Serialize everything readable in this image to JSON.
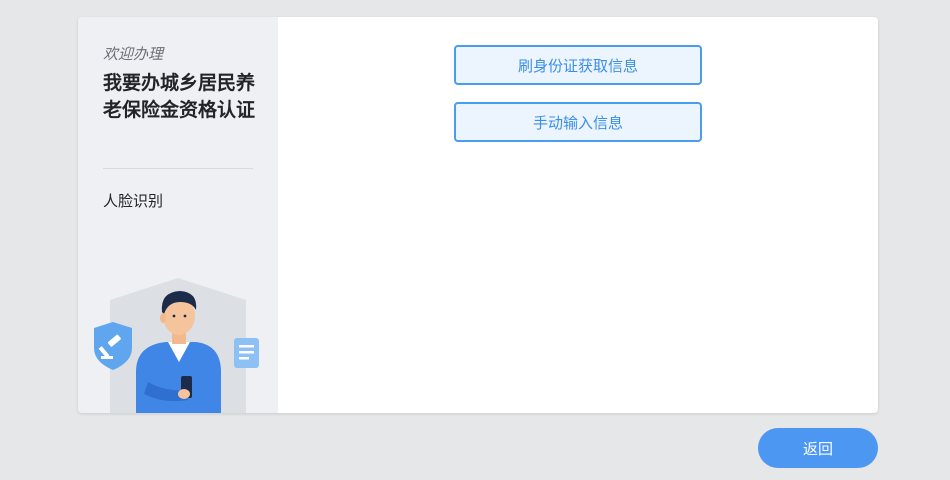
{
  "sidebar": {
    "welcome": "欢迎办理",
    "title": "我要办城乡居民养老保险金资格认证",
    "step": "人脸识别"
  },
  "options": {
    "swipe_id_label": "刷身份证获取信息",
    "manual_input_label": "手动输入信息"
  },
  "footer": {
    "back_label": "返回"
  },
  "colors": {
    "accent": "#4b97f2",
    "button_border": "#4a9cf0",
    "button_bg": "#ecf4fe",
    "sidebar_bg": "#eef0f3",
    "page_bg": "#e6e7e9"
  },
  "icons": [
    "shield-gavel-icon",
    "document-icon",
    "person-with-phone-illustration"
  ]
}
